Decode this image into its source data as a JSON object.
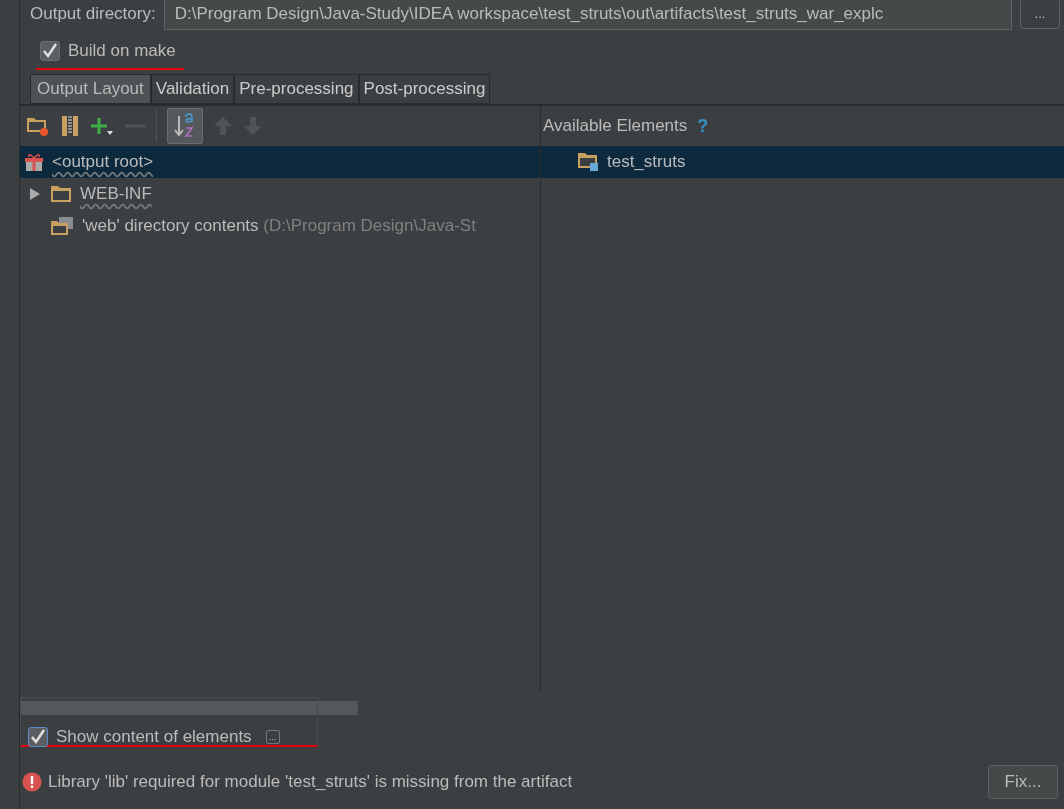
{
  "output_directory": {
    "label": "Output directory:",
    "value": "D:\\Program Design\\Java-Study\\IDEA workspace\\test_struts\\out\\artifacts\\test_struts_war_explc",
    "browse_button": "..."
  },
  "build_on_make": {
    "label": "Build on make",
    "checked": true
  },
  "tabs": [
    {
      "label": "Output Layout",
      "selected": true
    },
    {
      "label": "Validation",
      "selected": false
    },
    {
      "label": "Pre-processing",
      "selected": false
    },
    {
      "label": "Post-processing",
      "selected": false
    }
  ],
  "toolbar": [
    {
      "kind": "new-folder",
      "disabled": false,
      "toggled": false
    },
    {
      "kind": "archive",
      "disabled": false,
      "toggled": false
    },
    {
      "kind": "add",
      "disabled": false,
      "toggled": false
    },
    {
      "kind": "remove",
      "disabled": true,
      "toggled": false
    },
    {
      "kind": "separator",
      "disabled": false,
      "toggled": false
    },
    {
      "kind": "sort",
      "disabled": false,
      "toggled": true
    },
    {
      "kind": "up",
      "disabled": true,
      "toggled": false
    },
    {
      "kind": "down",
      "disabled": true,
      "toggled": false
    }
  ],
  "layout_tree": [
    {
      "label": "<output root>",
      "kind": "root",
      "selected": true,
      "children": [
        {
          "label": "WEB-INF",
          "kind": "folder",
          "selected": false,
          "expanded": false
        },
        {
          "label": "'web' directory contents",
          "detail": "(D:\\Program Design\\Java-St",
          "kind": "directory-contents",
          "selected": false
        }
      ]
    }
  ],
  "available_elements": {
    "title": "Available Elements",
    "help": "?",
    "items": [
      {
        "label": "test_struts",
        "selected": true
      }
    ]
  },
  "show_content": {
    "label": "Show content of elements",
    "checked": true,
    "more_button": "..."
  },
  "error": {
    "message": "Library 'lib' required for module 'test_struts' is missing from the artifact",
    "fix_button": "Fix..."
  }
}
